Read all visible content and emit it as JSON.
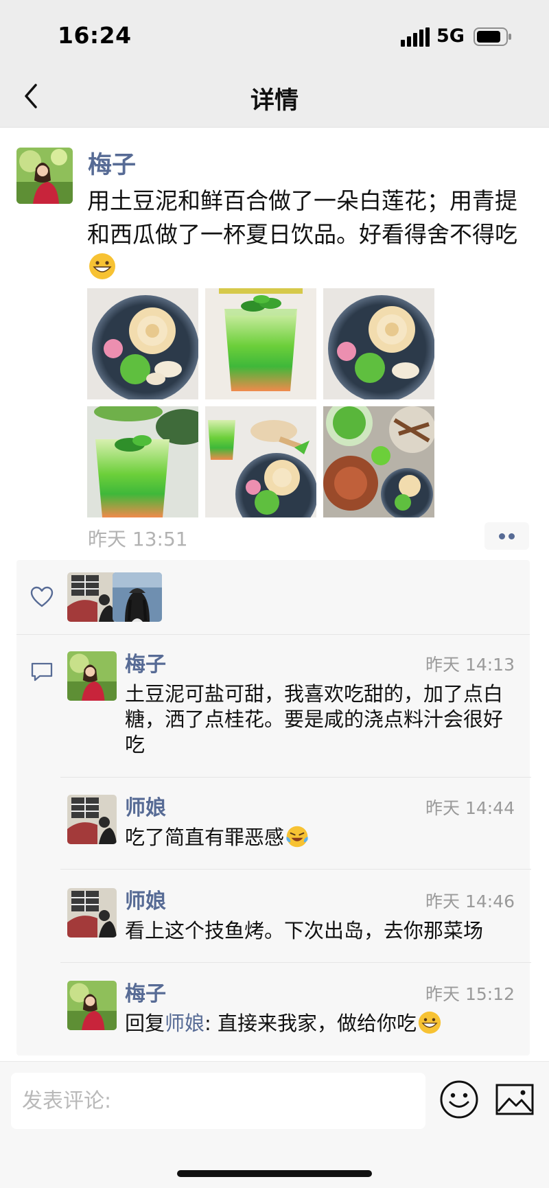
{
  "status_bar": {
    "time": "16:24",
    "network": "5G"
  },
  "nav": {
    "title": "详情"
  },
  "post": {
    "author": "梅子",
    "text": "用土豆泥和鲜百合做了一朵白莲花；用青提和西瓜做了一杯夏日饮品。好看得舍不得吃",
    "emoji": "grinning-face-emoji",
    "photos": [
      "lotus-potato-plate",
      "green-layered-drink",
      "lotus-potato-plate",
      "drink-with-dishes",
      "drink-and-lotus-table",
      "crab-and-dishes-table"
    ],
    "time": "昨天 13:51"
  },
  "likes": {
    "icon": "heart-icon",
    "avatars": [
      "师娘",
      "braided-hair-user"
    ]
  },
  "comments": [
    {
      "author": "梅子",
      "time": "昨天 14:13",
      "text": "土豆泥可盐可甜，我喜欢吃甜的，加了点白糖，洒了点桂花。要是咸的浇点料汁会很好吃"
    },
    {
      "author": "师娘",
      "time": "昨天 14:44",
      "text": "吃了简直有罪恶感",
      "emoji": "laughing-tears-emoji"
    },
    {
      "author": "师娘",
      "time": "昨天 14:46",
      "text": "看上这个技鱼烤。下次出岛，去你那菜场"
    },
    {
      "author": "梅子",
      "time": "昨天 15:12",
      "reply_prefix": "回复",
      "reply_to": "师娘",
      "text": ": 直接来我家，做给你吃",
      "emoji": "grinning-face-emoji"
    }
  ],
  "input": {
    "placeholder": "发表评论:"
  },
  "colors": {
    "link": "#576b95",
    "nav_bg": "#ededed",
    "panel_bg": "#f7f7f7",
    "meta_text": "#b2b2b2"
  }
}
